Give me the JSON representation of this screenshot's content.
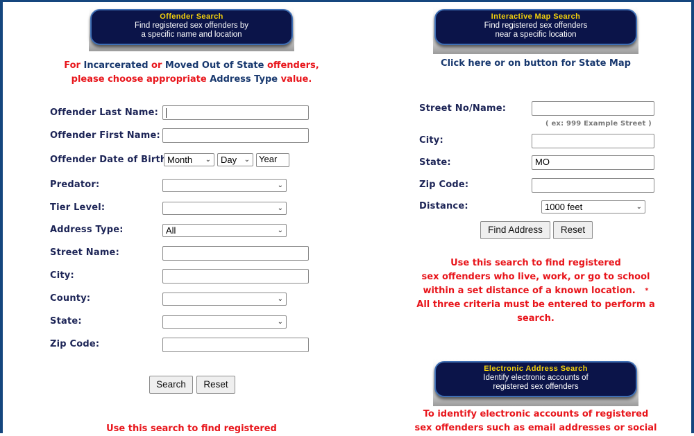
{
  "colors": {
    "frame": "#15467e",
    "banner_bg": "#0b1449",
    "banner_title": "#f5d20a",
    "alert_red": "#e8151b",
    "label_navy": "#1c2456",
    "link_navy": "#18386e"
  },
  "offender_search": {
    "banner": {
      "title": "Offender Search",
      "line1": "Find registered sex offenders by",
      "line2": "a specific name and location"
    },
    "notice": {
      "p1": "For ",
      "p2": "Incarcerated",
      "p3": " or ",
      "p4": "Moved Out of State",
      "p5": " offenders,",
      "p6": "please choose appropriate ",
      "p7": "Address Type",
      "p8": " value."
    },
    "fields": {
      "last_name": {
        "label": "Offender Last Name:",
        "value": ""
      },
      "first_name": {
        "label": "Offender First Name:",
        "value": ""
      },
      "dob": {
        "label": "Offender Date of Birth:",
        "month": "Month",
        "day": "Day",
        "year": "Year"
      },
      "predator": {
        "label": "Predator:",
        "value": ""
      },
      "tier_level": {
        "label": "Tier Level:",
        "value": ""
      },
      "address_type": {
        "label": "Address Type:",
        "value": "All"
      },
      "street_name": {
        "label": "Street Name:",
        "value": ""
      },
      "city": {
        "label": "City:",
        "value": ""
      },
      "county": {
        "label": "County:",
        "value": ""
      },
      "state": {
        "label": "State:",
        "value": ""
      },
      "zip": {
        "label": "Zip Code:",
        "value": ""
      }
    },
    "search_button": "Search",
    "reset_button": "Reset",
    "footer_text": "Use this search to find registered"
  },
  "map_search": {
    "banner": {
      "title": "Interactive Map Search",
      "line1": "Find registered sex offenders",
      "line2": "near a specific location"
    },
    "state_map_link": "Click here or on button for State Map",
    "fields": {
      "street": {
        "label": "Street No/Name:",
        "value": "",
        "hint": "( ex: 999 Example Street )"
      },
      "city": {
        "label": "City:",
        "value": ""
      },
      "state": {
        "label": "State:",
        "value": "MO"
      },
      "zip": {
        "label": "Zip Code:",
        "value": ""
      },
      "distance": {
        "label": "Distance:",
        "value": "1000 feet"
      }
    },
    "find_button": "Find Address",
    "reset_button": "Reset",
    "info": {
      "line1": "Use this search to find registered",
      "line2": "sex offenders who live, work, or go to school",
      "line3": "within a set distance of a known location.",
      "asterisk": "*",
      "line4": "All three criteria must be entered to perform a search."
    }
  },
  "electronic_search": {
    "banner": {
      "title": "Electronic Address Search",
      "line1": "Identify electronic accounts of",
      "line2": "registered sex offenders"
    },
    "info": {
      "line1": "To identify electronic accounts of registered",
      "line2": "sex offenders such as email addresses or social"
    }
  }
}
